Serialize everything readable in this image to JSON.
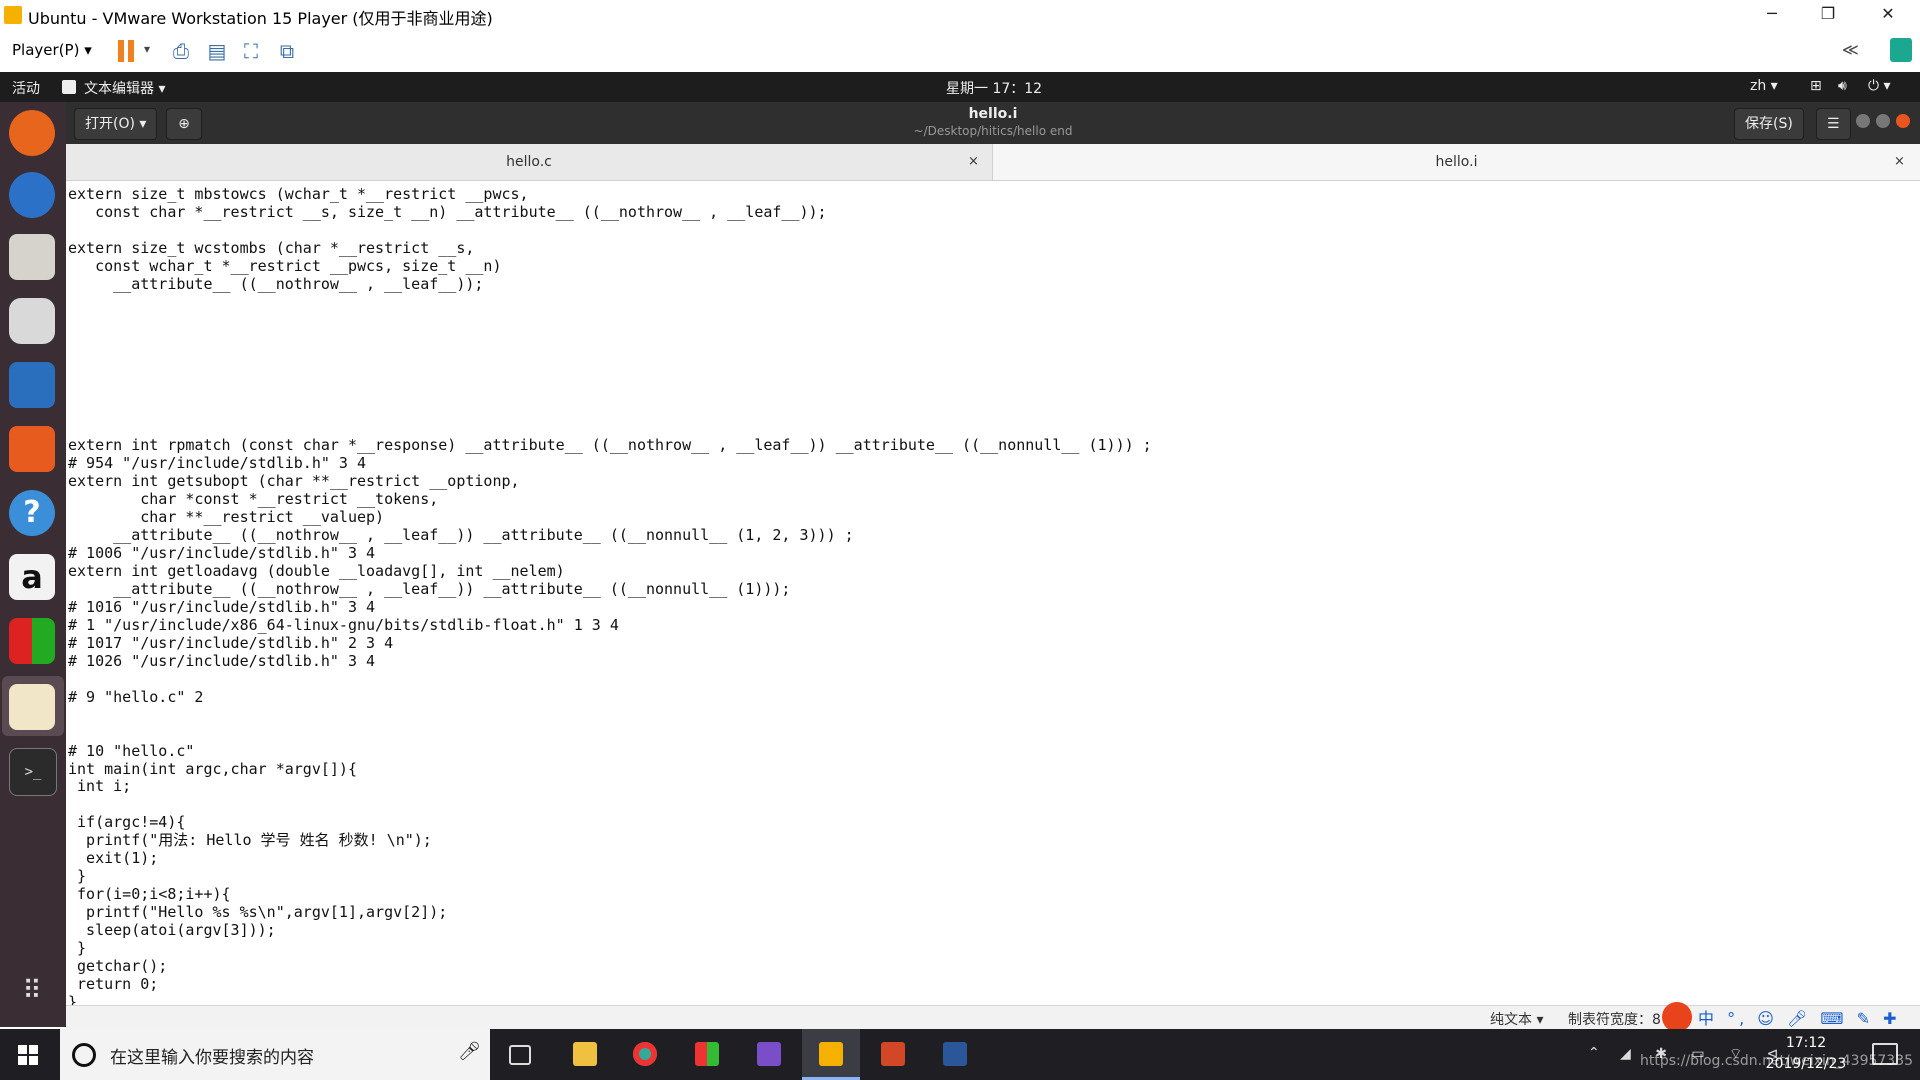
{
  "vm": {
    "title": "Ubuntu - VMware Workstation 15 Player (仅用于非商业用途)",
    "player_menu": "Player(P)",
    "window_buttons": [
      "─",
      "❐",
      "✕"
    ]
  },
  "gnome": {
    "activities": "活动",
    "app_menu": "文本编辑器",
    "clock": "星期一 17：12",
    "input_method": "zh"
  },
  "gedit": {
    "open_button": "打开(O)",
    "title": "hello.i",
    "subtitle": "~/Desktop/hitics/hello end",
    "save_button": "保存(S)",
    "tabs": [
      {
        "label": "hello.c"
      },
      {
        "label": "hello.i"
      }
    ],
    "code_lines": [
      "extern size_t mbstowcs (wchar_t *__restrict __pwcs,",
      "   const char *__restrict __s, size_t __n) __attribute__ ((__nothrow__ , __leaf__));",
      "",
      "extern size_t wcstombs (char *__restrict __s,",
      "   const wchar_t *__restrict __pwcs, size_t __n)",
      "     __attribute__ ((__nothrow__ , __leaf__));",
      "",
      "",
      "",
      "",
      "",
      "",
      "",
      "",
      "extern int rpmatch (const char *__response) __attribute__ ((__nothrow__ , __leaf__)) __attribute__ ((__nonnull__ (1))) ;",
      "# 954 \"/usr/include/stdlib.h\" 3 4",
      "extern int getsubopt (char **__restrict __optionp,",
      "        char *const *__restrict __tokens,",
      "        char **__restrict __valuep)",
      "     __attribute__ ((__nothrow__ , __leaf__)) __attribute__ ((__nonnull__ (1, 2, 3))) ;",
      "# 1006 \"/usr/include/stdlib.h\" 3 4",
      "extern int getloadavg (double __loadavg[], int __nelem)",
      "     __attribute__ ((__nothrow__ , __leaf__)) __attribute__ ((__nonnull__ (1)));",
      "# 1016 \"/usr/include/stdlib.h\" 3 4",
      "# 1 \"/usr/include/x86_64-linux-gnu/bits/stdlib-float.h\" 1 3 4",
      "# 1017 \"/usr/include/stdlib.h\" 2 3 4",
      "# 1026 \"/usr/include/stdlib.h\" 3 4",
      "",
      "# 9 \"hello.c\" 2",
      "",
      "",
      "# 10 \"hello.c\"",
      "int main(int argc,char *argv[]){",
      " int i;",
      "",
      " if(argc!=4){",
      "  printf(\"用法: Hello 学号 姓名 秒数! \\n\");",
      "  exit(1);",
      " }",
      " for(i=0;i<8;i++){",
      "  printf(\"Hello %s %s\\n\",argv[1],argv[2]);",
      "  sleep(atoi(argv[3]));",
      " }",
      " getchar();",
      " return 0;",
      "}"
    ],
    "status": {
      "language": "纯文本",
      "tab_width": "制表符宽度：8"
    }
  },
  "windows": {
    "search_placeholder": "在这里输入你要搜索的内容",
    "clock_time": "17:12",
    "clock_date": "2019/12/23",
    "watermark": "https://blog.csdn.net/weixin_43957335"
  },
  "colors": {
    "dock_bg": "#3a2d33",
    "gnome_bar": "#1d1d1d",
    "gedit_header": "#2f2f2f",
    "taskbar": "#1f1f23"
  }
}
